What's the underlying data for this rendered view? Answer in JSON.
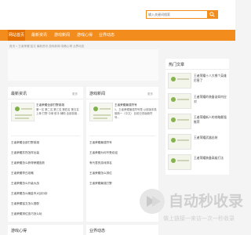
{
  "search": {
    "placeholder": "输入关键词搜索"
  },
  "nav": {
    "items": [
      {
        "label": "网站首页"
      },
      {
        "label": "最新资讯"
      },
      {
        "label": "游戏新闻"
      },
      {
        "label": "游戏心得"
      },
      {
        "label": "业界动态"
      }
    ]
  },
  "breadcrumb": "首页 > 王者荣耀 铭文 最新资讯 游戏新闻 攻略心得 业界动态",
  "latest": {
    "title": "最新资讯",
    "more": "更多",
    "feature_title": "王者荣耀全部打野英雄",
    "feature_desc": "第一名 第二名 第三名 第四名 第五名 上单 打野 中单 射手 辅助 全部英雄...",
    "items": [
      "王者荣耀全部打野英雄",
      "王者荣耀苏烈怎样出装",
      "王者荣耀怎么获得荣耀皮肤",
      "王者荣耀李白攻略",
      "王者荣耀怎么升级大战",
      "王者荣耀怎么赚金币大战分析",
      "王者荣耀铭文怎么搭配",
      "王者荣耀排位技巧怎么玩"
    ]
  },
  "games": {
    "title": "游戏新闻",
    "more": "更多",
    "feature_title": "王者荣耀最强符号",
    "feature_desc": "1、王者荣耀最强符号是 以前版本英雄新一（中文） 目前已改版新符号...",
    "items": [
      "王者荣耀最强符号",
      "王者荣耀为何不受欢迎",
      "有代表的游戏排名",
      "王者荣耀怎么排位",
      "王者荣耀最强打野"
    ]
  },
  "bottom": {
    "left_title": "游戏心得",
    "right_title": "业界动态"
  },
  "sidebar": {
    "title": "热门文章",
    "items": [
      "王者荣耀十八大哪个英雄厉害了",
      "王者荣耀的装备该如何应对",
      "王者荣耀新人的攻略最强推荐",
      "王者荣耀武器出装",
      "王者荣耀装备高级打法"
    ]
  },
  "watermark": {
    "brand": "自动秒收录",
    "slogan": "做上链接一来访一次一秒收录"
  },
  "colors": {
    "accent": "#f28c1c",
    "nav_active": "#e26f00",
    "background": "#f4f4f4"
  }
}
